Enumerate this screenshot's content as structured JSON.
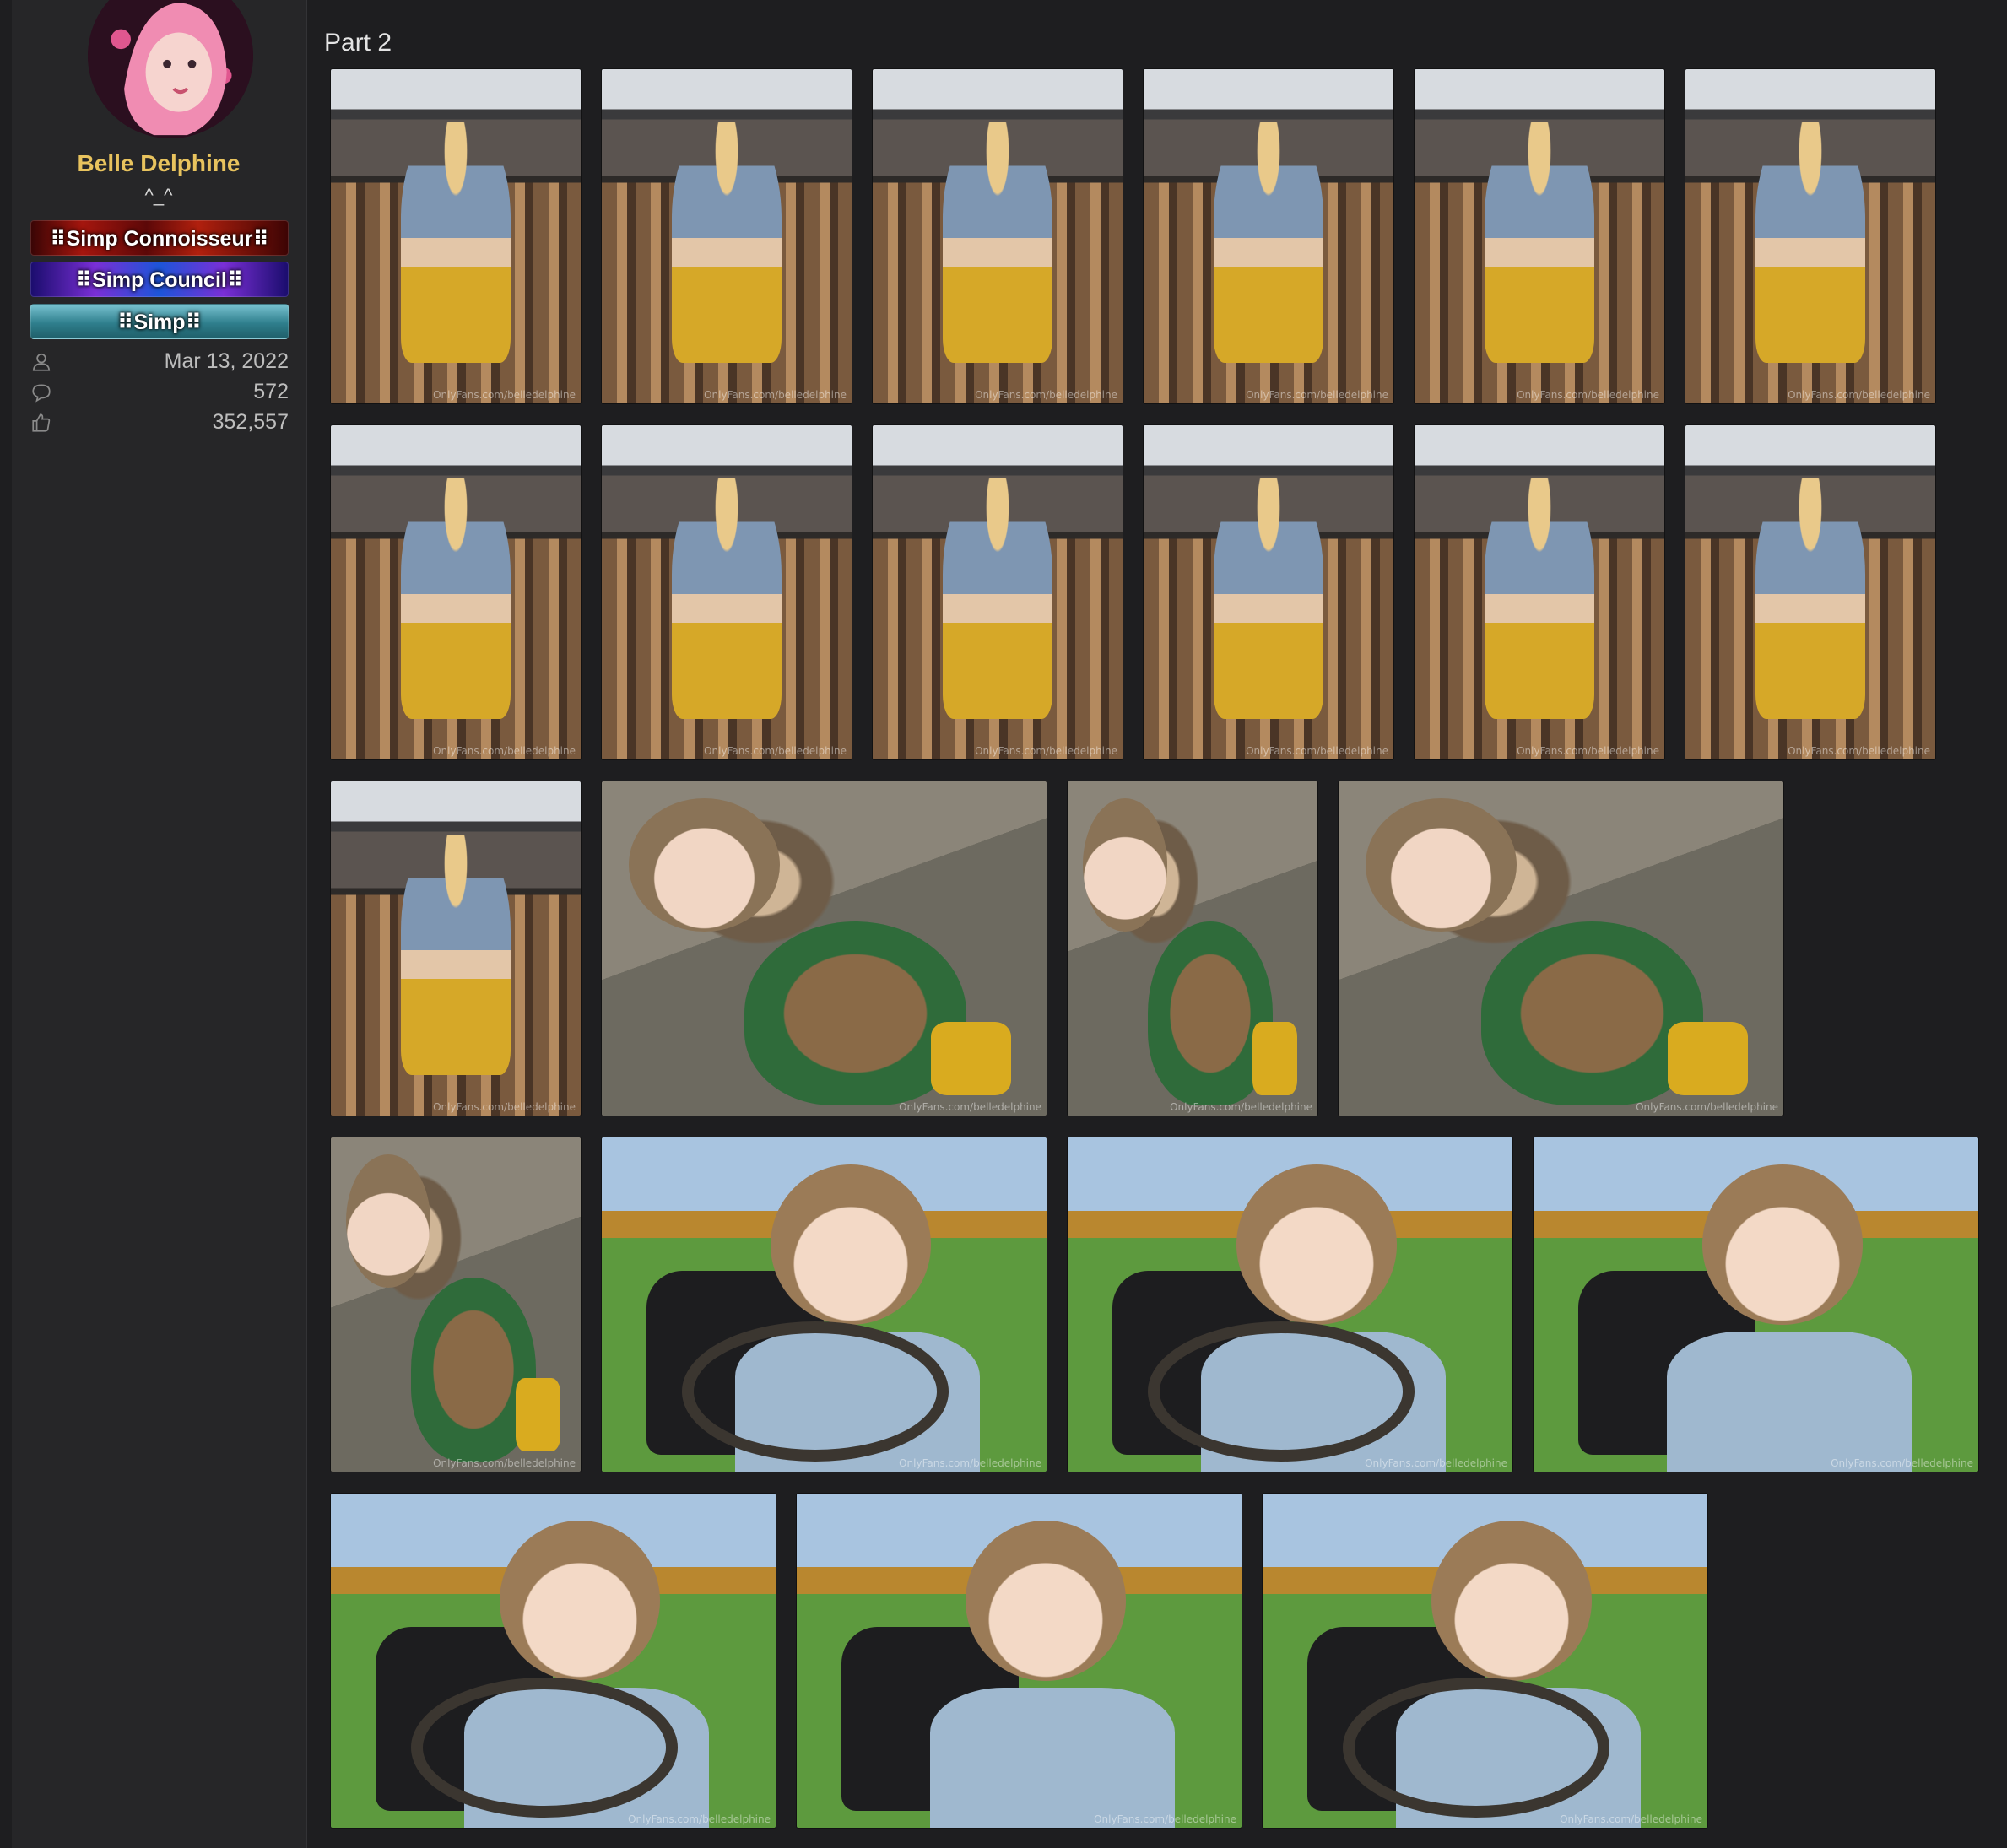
{
  "user": {
    "name": "Belle Delphine",
    "title": "^_^",
    "banners": [
      "⠿Simp Connoisseur⠿",
      "⠿Simp Council⠿",
      "⠿Simp⠿"
    ],
    "stats": {
      "joined": "Mar 13, 2022",
      "messages": "572",
      "reactions": "352,557"
    },
    "icons": {
      "joined": "user-icon",
      "messages": "comment-icon",
      "reactions": "thumbs-up-icon"
    }
  },
  "post": {
    "heading": "Part 2",
    "watermark": "OnlyFans.com/belledelphine"
  },
  "colors": {
    "background": "#1e1e20",
    "sidebar": "#262628",
    "username": "#e8c35e",
    "text": "#bdbdbd"
  }
}
